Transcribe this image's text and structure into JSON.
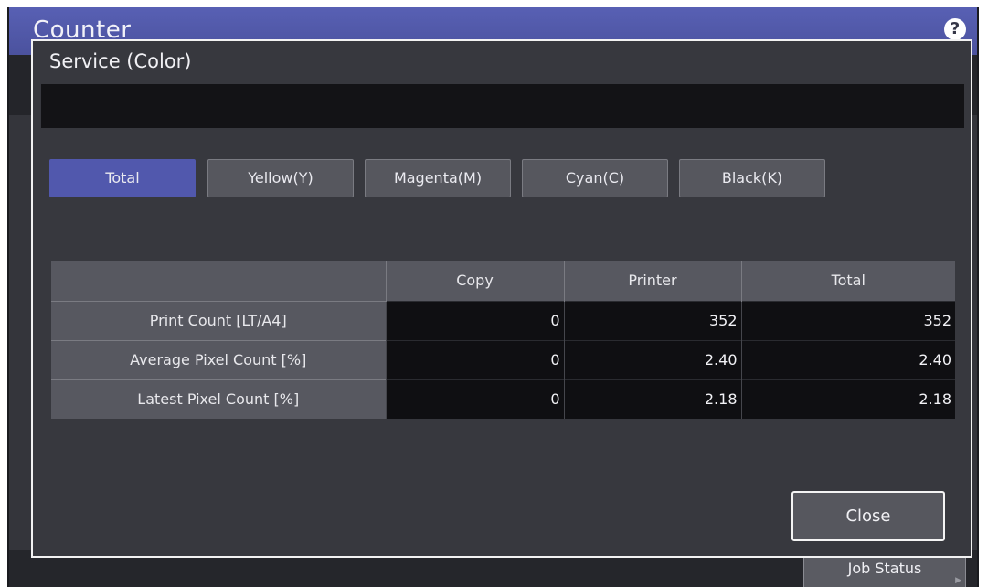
{
  "background": {
    "title": "Counter",
    "help_icon": "?",
    "job_status_label": "Job Status"
  },
  "dialog": {
    "title": "Service (Color)",
    "message": "",
    "tabs": [
      {
        "label": "Total",
        "active": true
      },
      {
        "label": "Yellow(Y)",
        "active": false
      },
      {
        "label": "Magenta(M)",
        "active": false
      },
      {
        "label": "Cyan(C)",
        "active": false
      },
      {
        "label": "Black(K)",
        "active": false
      }
    ],
    "table": {
      "columns": [
        "",
        "Copy",
        "Printer",
        "Total"
      ],
      "rows": [
        {
          "label": "Print Count [LT/A4]",
          "copy": "0",
          "printer": "352",
          "total": "352"
        },
        {
          "label": "Average Pixel Count [%]",
          "copy": "0",
          "printer": "2.40",
          "total": "2.40"
        },
        {
          "label": "Latest Pixel Count [%]",
          "copy": "0",
          "printer": "2.18",
          "total": "2.18"
        }
      ]
    },
    "close_label": "Close"
  },
  "colors": {
    "accent": "#5158ad",
    "dialog_bg": "#37383e",
    "cell_bg": "#0f0f12"
  }
}
